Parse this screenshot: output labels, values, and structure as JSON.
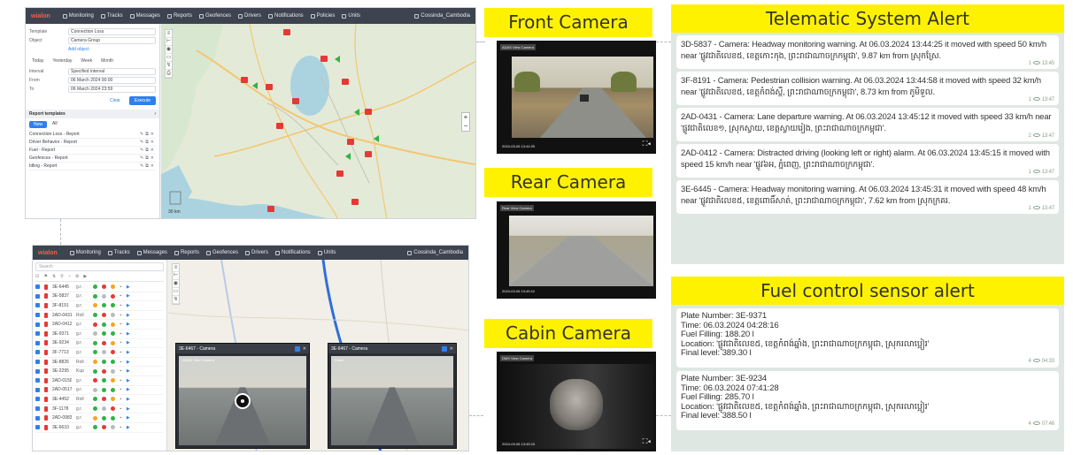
{
  "app": {
    "brand": "wialon",
    "nav": [
      "Monitoring",
      "Tracks",
      "Messages",
      "Reports",
      "Geofences",
      "Drivers",
      "Notifications",
      "Policies",
      "Units"
    ],
    "user": "Cossinda_Cambodia"
  },
  "report_panel": {
    "fields": [
      {
        "label": "Template",
        "value": "Connection Loss"
      },
      {
        "label": "Object",
        "value": "Camera Group"
      },
      {
        "label": "",
        "value": "Add object"
      }
    ],
    "ranges": [
      "Today",
      "Yesterday",
      "Week",
      "Month"
    ],
    "interval_fields": [
      {
        "label": "Interval",
        "value": "Specified interval"
      },
      {
        "label": "From",
        "value": "06 March 2024 00:00"
      },
      {
        "label": "To",
        "value": "06 March 2024 23:59"
      }
    ],
    "clear_label": "Clear",
    "execute_label": "Execute",
    "templates_title": "Report templates",
    "templates_tabs": [
      "New",
      "All"
    ],
    "templates": [
      "Connection Loss - Report",
      "Driver Behavior - Report",
      "Fuel - Report",
      "Geofences - Report",
      "Idling - Report"
    ]
  },
  "map": {
    "scale_label": "30 km"
  },
  "monitor": {
    "search_placeholder": "Search",
    "units": [
      {
        "name": "3E-6445",
        "short": "g.r."
      },
      {
        "name": "3E-5837",
        "short": "g.r."
      },
      {
        "name": "3F-8191",
        "short": "g.r."
      },
      {
        "name": "2AD-0431",
        "short": "Roll"
      },
      {
        "name": "2AD-0412",
        "short": "g.r."
      },
      {
        "name": "3E-9371",
        "short": "g.r."
      },
      {
        "name": "3E-9234",
        "short": "g.r."
      },
      {
        "name": "3F-7713",
        "short": "g.r."
      },
      {
        "name": "3E-8826",
        "short": "Roll"
      },
      {
        "name": "3E-2295",
        "short": "Kup"
      },
      {
        "name": "2AD-0150",
        "short": "g.r."
      },
      {
        "name": "2AD-0517",
        "short": "g.r."
      },
      {
        "name": "3E-4452",
        "short": "Roll"
      },
      {
        "name": "3F-1178",
        "short": "g.r."
      },
      {
        "name": "2AD-0983",
        "short": "g.r."
      },
      {
        "name": "3E-6610",
        "short": "g.r."
      }
    ],
    "cam1_title": "3E-6467 - Camera",
    "cam1_sub": "ADAS View Camera",
    "cam2_title": "3E-6467 - Camera",
    "cam2_sub": "Road"
  },
  "cameras": [
    {
      "label": "Front Camera",
      "overlay": "ADAS View Camera",
      "timestamp": "2024-03-06 13:44:25"
    },
    {
      "label": "Rear Camera",
      "overlay": "Rear View Camera",
      "timestamp": "2024-03-06 13:45:12"
    },
    {
      "label": "Cabin Camera",
      "overlay": "DMS View Camera",
      "timestamp": "2024-03-06 13:45:15"
    }
  ],
  "telematic": {
    "title": "Telematic System Alert",
    "alerts": [
      {
        "text": "3D-5837 - Camera: Headway monitoring warning. At 06.03.2024 13:44:25 it moved with speed 50 km/h near 'ផ្លូវជាតិលេខ៥, ខេត្តកោះកុង, ព្រះរាជាណាចក្រកម្ពុជា', 9.87 km from ស្រុកស្រែ.",
        "views": "1",
        "time": "13:45"
      },
      {
        "text": "3F-8191 - Camera: Pedestrian collision warning. At 06.03.2024 13:44:58 it moved with speed 32 km/h near 'ផ្លូវជាតិលេខ៥, ខេត្តកំពង់ស្ពឺ, ព្រះរាជាណាចក្រកម្ពុជា', 8.73 km from ភូមិទួល.",
        "views": "1",
        "time": "13:47"
      },
      {
        "text": "2AD-0431 - Camera: Lane departure warning. At 06.03.2024 13:45:12 it moved with speed 33 km/h near 'ផ្លូវជាតិលេខ១, ស្រុកស្វាយ, ខេត្តស្វាយរៀង, ព្រះរាជាណាចក្រកម្ពុជា'.",
        "views": "2",
        "time": "13:47"
      },
      {
        "text": "2AD-0412 - Camera: Distracted driving (looking left or right) alarm. At 06.03.2024 13:45:15 it moved with speed 15 km/h near 'ផ្លូវ៦អ, ភ្នំពេញ, ព្រះរាជាណាចក្រកម្ពុជា'.",
        "views": "1",
        "time": "13:47"
      },
      {
        "text": "3E-6445 - Camera: Headway monitoring warning. At 06.03.2024 13:45:31 it moved with speed 48 km/h near 'ផ្លូវជាតិលេខ៥, ខេត្តពោធិ៍សាត់, ព្រះរាជាណាចក្រកម្ពុជា', 7.62 km from ស្រុកក្រគរ.",
        "views": "1",
        "time": "13:47"
      }
    ]
  },
  "fuel": {
    "title": "Fuel control sensor alert",
    "alerts": [
      {
        "plate": "Plate Number: 3E-9371",
        "time": "Time: 06.03.2024 04:28:16",
        "filling": "Fuel Filling: 188.20 l",
        "location": "Location: 'ផ្លូវជាតិលេខ៥, ខេត្តកំពង់ឆ្នាំង, ព្រះរាជាណាចក្រកម្ពុជា, ស្រុករលាប្អៀរ'",
        "final": "Final level: 389.30 l",
        "views": "4",
        "clock": "04:33"
      },
      {
        "plate": "Plate Number: 3E-9234",
        "time": "Time: 06.03.2024 07:41:28",
        "filling": "Fuel Filling: 285.70 l",
        "location": "Location: 'ផ្លូវជាតិលេខ៥, ខេត្តកំពង់ឆ្នាំង, ព្រះរាជាណាចក្រកម្ពុជា, ស្រុករលាប្អៀរ'",
        "final": "Final level: 388.50 l",
        "views": "4",
        "clock": "07:46"
      }
    ]
  },
  "colors": {
    "highlight": "#fff200",
    "alert_bg": "#dfe7e2",
    "accent": "#2f80ed",
    "topbar": "#3d4450"
  }
}
